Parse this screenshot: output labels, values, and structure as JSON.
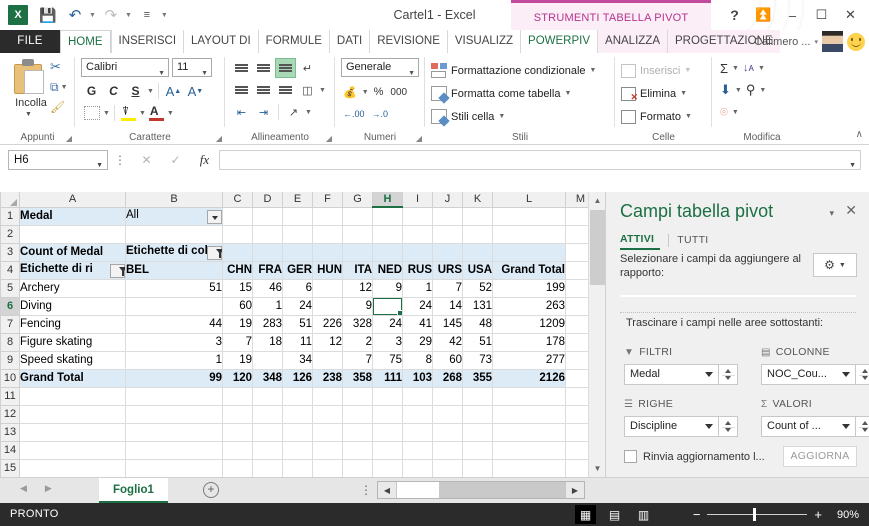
{
  "titlebar": {
    "doc_title": "Cartel1 - Excel",
    "contextual_tools": "STRUMENTI TABELLA PIVOT",
    "quick_access": [
      {
        "name": "save-icon",
        "glyph": "ὋE"
      },
      {
        "name": "undo-icon",
        "glyph": "↶"
      },
      {
        "name": "redo-icon",
        "glyph": "↷"
      },
      {
        "name": "customize-qat-icon",
        "glyph": "☰"
      }
    ],
    "help_label": "?",
    "ribbon_display_label": "⤓",
    "minimize_label": "–",
    "restore_label": "☐",
    "close_label": "✕"
  },
  "tabs": {
    "file": "FILE",
    "items": [
      {
        "label": "HOME",
        "state": "active"
      },
      {
        "label": "INSERISCI",
        "state": "normal"
      },
      {
        "label": "LAYOUT DI",
        "state": "normal"
      },
      {
        "label": "FORMULE",
        "state": "normal"
      },
      {
        "label": "DATI",
        "state": "normal"
      },
      {
        "label": "REVISIONE",
        "state": "normal"
      },
      {
        "label": "VISUALIZZ",
        "state": "normal"
      },
      {
        "label": "POWERPIV",
        "state": "green"
      },
      {
        "label": "ANALIZZA",
        "state": "pivot"
      },
      {
        "label": "PROGETTAZIONE",
        "state": "pivot"
      }
    ],
    "user_name": "Calimero ...",
    "user_caret": "▾"
  },
  "ribbon": {
    "groups": [
      {
        "label": "Appunti"
      },
      {
        "label": "Carattere"
      },
      {
        "label": "Allineamento"
      },
      {
        "label": "Numeri"
      },
      {
        "label": "Stili"
      },
      {
        "label": "Celle"
      },
      {
        "label": "Modifica"
      }
    ],
    "clipboard": {
      "paste_label": "Incolla",
      "cut_label": "✂",
      "copy_label": "⧉",
      "format_painter_label": "✎"
    },
    "font": {
      "family_value": "Calibri",
      "size_value": "11",
      "bold_label": "G",
      "italic_label": "C",
      "underline_label": "S",
      "grow_label": "A",
      "shrink_label": "A",
      "borders_label": "▦",
      "fill_label": "▣",
      "fontcolor_label": "A",
      "fill_color": "#ffeb00",
      "fontcolor_color": "#c0392b"
    },
    "alignment": {
      "top_label": "≡",
      "middle_label": "≡",
      "bottom_label": "≡",
      "wrap_label": "↵",
      "left_label": "≡",
      "center_label": "≡",
      "right_label": "≡",
      "merge_label": "▦",
      "indent_dec_label": "←",
      "indent_inc_label": "→",
      "orientation_label": "↗"
    },
    "numbers": {
      "format_value": "Generale",
      "currency_label": "€",
      "percent_label": "%",
      "thousands_label": "000",
      "inc_dec_label": ".00",
      "dec_dec_label": ".0"
    },
    "styles": {
      "conditional_label": "Formattazione condizionale",
      "table_label": "Formatta come tabella",
      "cell_label": "Stili cella"
    },
    "cells": {
      "insert_label": "Inserisci",
      "delete_label": "Elimina",
      "format_label": "Formato"
    },
    "editing": {
      "autosum_label": "Σ",
      "fill_label": "↓",
      "clear_label": "⌫",
      "sort_label": "A↓",
      "find_label": "☍"
    },
    "collapse_label": "∧"
  },
  "formula_bar": {
    "name_box_value": "H6",
    "name_box_caret": "▾",
    "cancel_label": "✕",
    "confirm_label": "✓",
    "fx_label": "fx",
    "formula_value": "",
    "formula_caret": "▾"
  },
  "grid": {
    "columns": [
      "A",
      "B",
      "C",
      "D",
      "E",
      "F",
      "G",
      "H",
      "I",
      "J",
      "K",
      "L",
      "M"
    ],
    "selected_column": "H",
    "selected_row": "6",
    "rows": [
      "1",
      "2",
      "3",
      "4",
      "5",
      "6",
      "7",
      "8",
      "9",
      "10",
      "11",
      "12",
      "13",
      "14",
      "15"
    ],
    "cells": {
      "r1": {
        "A": "Medal",
        "B": "All"
      },
      "r3": {
        "A": "Count of Medal",
        "B": "Etichette di col"
      },
      "r4": {
        "A": "Etichette di ri",
        "B": "BEL",
        "C": "CHN",
        "D": "FRA",
        "E": "GER",
        "F": "HUN",
        "G": "ITA",
        "H": "NED",
        "I": "RUS",
        "J": "URS",
        "K": "USA",
        "L": "Grand Total"
      }
    },
    "data_rows": [
      {
        "row": "5",
        "label": "Archery",
        "values": [
          "51",
          "15",
          "46",
          "6",
          "",
          "12",
          "9",
          "1",
          "7",
          "52"
        ],
        "total": "199"
      },
      {
        "row": "6",
        "label": "Diving",
        "values": [
          "",
          "60",
          "1",
          "24",
          "",
          "9",
          "",
          "24",
          "14",
          "131"
        ],
        "total": "263"
      },
      {
        "row": "7",
        "label": "Fencing",
        "values": [
          "44",
          "19",
          "283",
          "51",
          "226",
          "328",
          "24",
          "41",
          "145",
          "48"
        ],
        "total": "1209"
      },
      {
        "row": "8",
        "label": "Figure skating",
        "values": [
          "3",
          "7",
          "18",
          "11",
          "12",
          "2",
          "3",
          "29",
          "42",
          "51"
        ],
        "total": "178"
      },
      {
        "row": "9",
        "label": "Speed skating",
        "values": [
          "1",
          "19",
          "",
          "34",
          "",
          "7",
          "75",
          "8",
          "60",
          "73"
        ],
        "total": "277"
      }
    ],
    "grand_total": {
      "row": "10",
      "label": "Grand Total",
      "values": [
        "99",
        "120",
        "348",
        "126",
        "238",
        "358",
        "111",
        "103",
        "268",
        "355"
      ],
      "total": "2126"
    }
  },
  "field_pane": {
    "title": "Campi tabella pivot",
    "collapse_label": "▾",
    "close_label": "✕",
    "tab_active": "ATTIVI",
    "tab_all": "TUTTI",
    "hint": "Selezionare i campi da aggiungere al rapporto:",
    "gear_label": "⚙",
    "gear_caret": "▾",
    "drag_hint": "Trascinare i campi nelle aree sottostanti:",
    "areas": [
      {
        "name": "filters",
        "icon": "filter-icon",
        "header": "FILTRI",
        "field": "Medal"
      },
      {
        "name": "columns",
        "icon": "columns-icon",
        "header": "COLONNE",
        "field": "NOC_Cou..."
      },
      {
        "name": "rows",
        "icon": "rows-icon",
        "header": "RIGHE",
        "field": "Discipline"
      },
      {
        "name": "values",
        "icon": "sigma-icon",
        "header": "VALORI",
        "field": "Count of ..."
      }
    ],
    "defer_label": "Rinvia aggiornamento l...",
    "update_label": "AGGIORNA"
  },
  "sheet_bar": {
    "prev_label": "◀",
    "next_label": "▶",
    "sheet_name": "Foglio1",
    "add_label": "+",
    "menu_label": "⋮",
    "hs_left": "◀",
    "hs_right": "▶"
  },
  "status_bar": {
    "state": "PRONTO",
    "views": [
      {
        "name": "normal-view-icon",
        "glyph": "▦",
        "active": true
      },
      {
        "name": "page-layout-icon",
        "glyph": "▤",
        "active": false
      },
      {
        "name": "page-break-icon",
        "glyph": "▥",
        "active": false
      }
    ],
    "zoom_out_label": "−",
    "zoom_in_label": "+",
    "zoom_value": "90%"
  },
  "colors": {
    "excel_green": "#1d7044",
    "pivot_pink": "#c14a9c",
    "pivot_pink_bg": "#fbeef6",
    "pivot_cell_bg": "#ddebf7",
    "status_bar": "#2b2b2b"
  }
}
